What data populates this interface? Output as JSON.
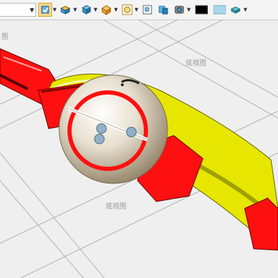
{
  "toolbar": {
    "buttons": [
      {
        "icon": "fit-view-icon",
        "active": true,
        "dropdown": true
      },
      {
        "icon": "display-style-icon",
        "active": false,
        "dropdown": true
      },
      {
        "icon": "view-cube-icon",
        "active": false,
        "dropdown": true
      },
      {
        "icon": "box-view-icon",
        "active": false,
        "dropdown": true
      },
      {
        "icon": "zoom-area-icon",
        "active": false,
        "dropdown": true
      },
      {
        "icon": "window-view-icon",
        "active": false,
        "dropdown": false
      },
      {
        "icon": "section-view-icon",
        "active": false,
        "dropdown": false
      },
      {
        "icon": "camera-icon",
        "active": false,
        "dropdown": true
      },
      {
        "icon": "black-color-swatch",
        "active": false,
        "dropdown": false
      },
      {
        "icon": "light-blue-color-swatch",
        "active": false,
        "dropdown": false
      },
      {
        "icon": "material-icon",
        "active": false,
        "dropdown": true
      }
    ],
    "colors": {
      "black_swatch": "#000000",
      "blue_swatch": "#a8d8ec"
    }
  },
  "viewport": {
    "labels": {
      "bottom_view_1": "底视图",
      "bottom_view_2": "底视图",
      "partial_left": "图"
    },
    "colors": {
      "background": "#efefef",
      "model_yellow": "#e6e600",
      "model_red": "#ff1010",
      "sphere": "#e8e0d0",
      "point": "#8fb0c8"
    }
  }
}
